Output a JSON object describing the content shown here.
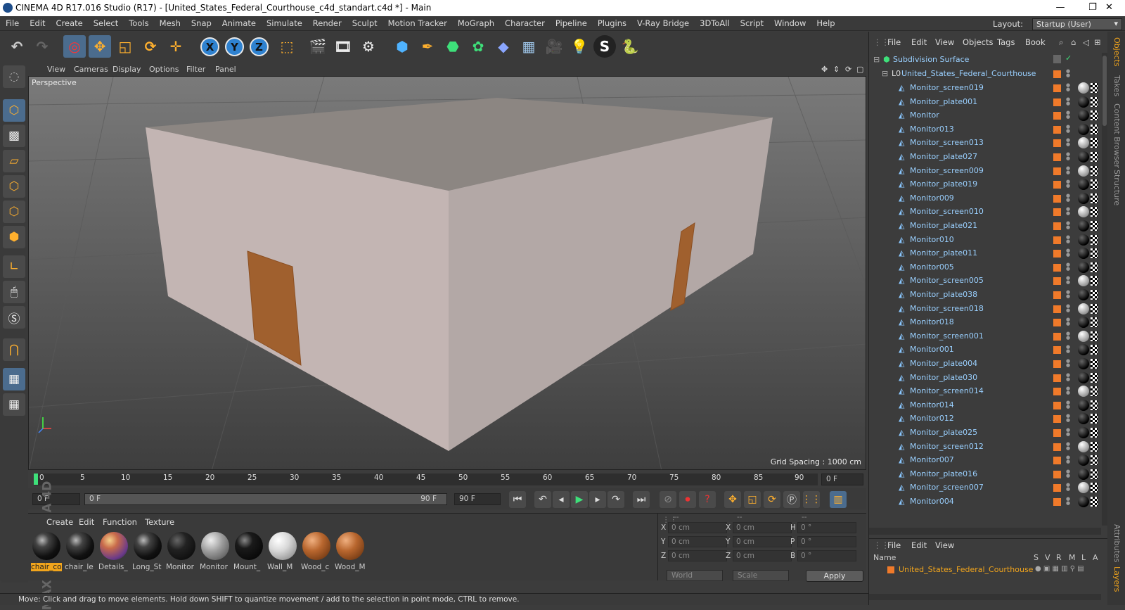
{
  "window": {
    "title": "CINEMA 4D R17.016 Studio (R17) - [United_States_Federal_Courthouse_c4d_standart.c4d *] - Main",
    "minimize": "—",
    "maximize": "❐",
    "close": "✕"
  },
  "menu": [
    "File",
    "Edit",
    "Create",
    "Select",
    "Tools",
    "Mesh",
    "Snap",
    "Animate",
    "Simulate",
    "Render",
    "Sculpt",
    "Motion Tracker",
    "MoGraph",
    "Character",
    "Pipeline",
    "Plugins",
    "V-Ray Bridge",
    "3DToAll",
    "Script",
    "Window",
    "Help"
  ],
  "layout": {
    "label": "Layout:",
    "value": "Startup (User)"
  },
  "viewport": {
    "menu": [
      "View",
      "Cameras",
      "Display",
      "Options",
      "Filter",
      "Panel"
    ],
    "camera": "Perspective",
    "grid_spacing": "Grid Spacing : 1000 cm"
  },
  "timeline": {
    "ticks": [
      "0",
      "5",
      "10",
      "15",
      "20",
      "25",
      "30",
      "35",
      "40",
      "45",
      "50",
      "55",
      "60",
      "65",
      "70",
      "75",
      "80",
      "85",
      "90"
    ],
    "current": "0 F",
    "start": "0 F",
    "slider_start": "0 F",
    "slider_end": "90 F",
    "end": "90 F"
  },
  "materials": {
    "menu": [
      "Create",
      "Edit",
      "Function",
      "Texture"
    ],
    "items": [
      {
        "label": "chair_co",
        "style": "dark-stripe",
        "selected": true
      },
      {
        "label": "chair_le",
        "style": "dark-stripe",
        "selected": false
      },
      {
        "label": "Details_",
        "style": "multi",
        "selected": false
      },
      {
        "label": "Long_St",
        "style": "dark-stripe",
        "selected": false
      },
      {
        "label": "Monitor",
        "style": "black",
        "selected": false
      },
      {
        "label": "Monitor",
        "style": "grey",
        "selected": false
      },
      {
        "label": "Mount_",
        "style": "black-spec",
        "selected": false
      },
      {
        "label": "Wall_M",
        "style": "light",
        "selected": false
      },
      {
        "label": "Wood_c",
        "style": "wood",
        "selected": false
      },
      {
        "label": "Wood_M",
        "style": "wood",
        "selected": false
      }
    ]
  },
  "coords": {
    "header": [
      "--",
      "--",
      "--"
    ],
    "rows": [
      {
        "a": "X",
        "av": "0 cm",
        "b": "X",
        "bv": "0 cm",
        "c": "H",
        "cv": "0 °"
      },
      {
        "a": "Y",
        "av": "0 cm",
        "b": "Y",
        "bv": "0 cm",
        "c": "P",
        "cv": "0 °"
      },
      {
        "a": "Z",
        "av": "0 cm",
        "b": "Z",
        "bv": "0 cm",
        "c": "B",
        "cv": "0 °"
      }
    ],
    "space": "World",
    "mode": "Scale",
    "apply": "Apply"
  },
  "status": "Move: Click and drag to move elements. Hold down SHIFT to quantize movement / add to the selection in point mode, CTRL to remove.",
  "objects": {
    "menu": [
      "File",
      "Edit",
      "View",
      "Objects",
      "Tags",
      "Book"
    ],
    "root": "Subdivision Surface",
    "group": "United_States_Federal_Courthouse",
    "items": [
      "Monitor_screen019",
      "Monitor_plate001",
      "Monitor",
      "Monitor013",
      "Monitor_screen013",
      "Monitor_plate027",
      "Monitor_screen009",
      "Monitor_plate019",
      "Monitor009",
      "Monitor_screen010",
      "Monitor_plate021",
      "Monitor010",
      "Monitor_plate011",
      "Monitor005",
      "Monitor_screen005",
      "Monitor_plate038",
      "Monitor_screen018",
      "Monitor018",
      "Monitor_screen001",
      "Monitor001",
      "Monitor_plate004",
      "Monitor_plate030",
      "Monitor_screen014",
      "Monitor014",
      "Monitor012",
      "Monitor_plate025",
      "Monitor_screen012",
      "Monitor007",
      "Monitor_plate016",
      "Monitor_screen007",
      "Monitor004"
    ]
  },
  "layers": {
    "menu": [
      "File",
      "Edit",
      "View"
    ],
    "cols": {
      "name": "Name",
      "flags": [
        "S",
        "V",
        "R",
        "M",
        "L",
        "A"
      ]
    },
    "item": "United_States_Federal_Courthouse"
  },
  "sidetabs": [
    "Objects",
    "Takes",
    "Content Browser",
    "Structure",
    "Attributes",
    "Layers"
  ],
  "maxon": "MAXON CINEMA 4D"
}
